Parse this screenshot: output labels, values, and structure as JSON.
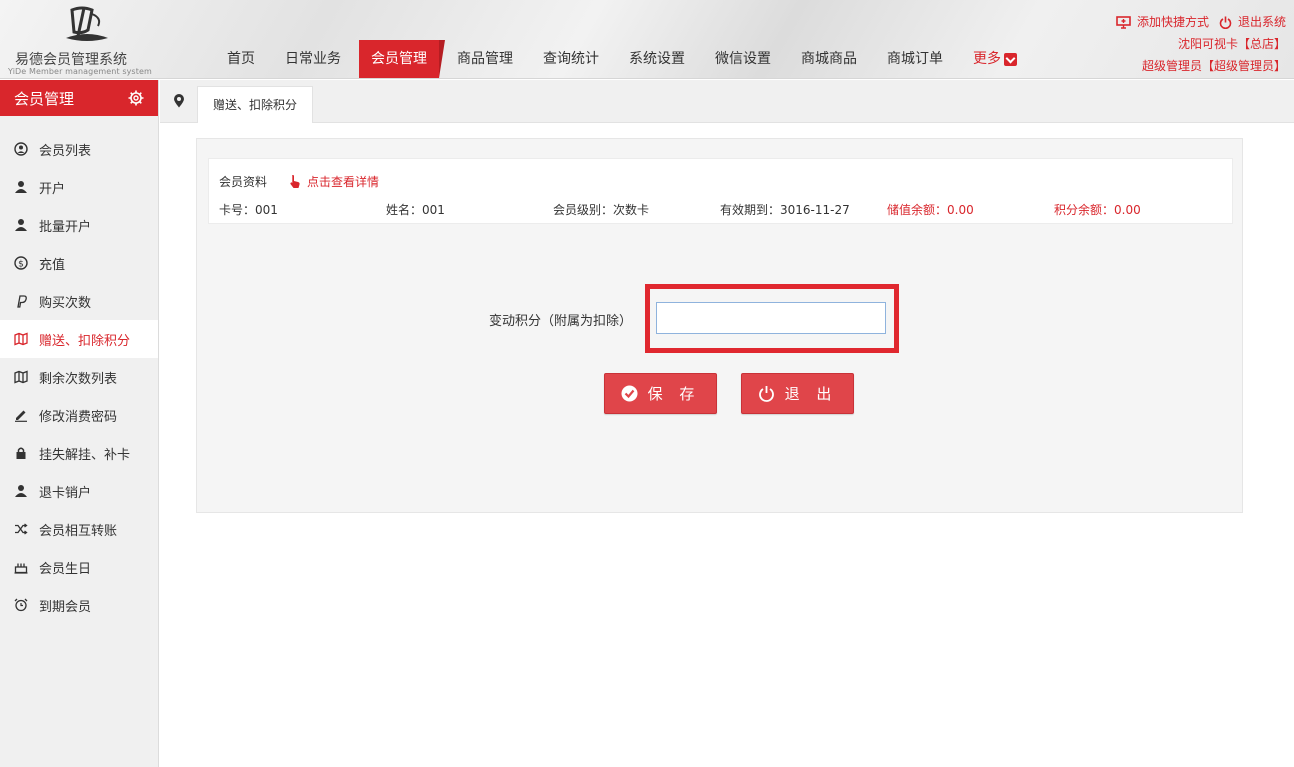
{
  "header": {
    "logo_title": "易德会员管理系统",
    "logo_subtitle": "YiDe Member management system",
    "nav": [
      "首页",
      "日常业务",
      "会员管理",
      "商品管理",
      "查询统计",
      "系统设置",
      "微信设置",
      "商城商品",
      "商城订单"
    ],
    "nav_more": "更多",
    "add_shortcut": "添加快捷方式",
    "logout": "退出系统",
    "store": "沈阳可视卡【总店】",
    "user": "超级管理员【超级管理员】"
  },
  "sidebar": {
    "title": "会员管理",
    "items": [
      {
        "label": "会员列表",
        "icon": "user-circle-icon"
      },
      {
        "label": "开户",
        "icon": "user-icon"
      },
      {
        "label": "批量开户",
        "icon": "user-icon"
      },
      {
        "label": "充值",
        "icon": "coin-icon"
      },
      {
        "label": "购买次数",
        "icon": "paypal-icon"
      },
      {
        "label": "赠送、扣除积分",
        "icon": "map-icon"
      },
      {
        "label": "剩余次数列表",
        "icon": "map-icon"
      },
      {
        "label": "修改消费密码",
        "icon": "pencil-icon"
      },
      {
        "label": "挂失解挂、补卡",
        "icon": "lock-icon"
      },
      {
        "label": "退卡销户",
        "icon": "user-icon"
      },
      {
        "label": "会员相互转账",
        "icon": "shuffle-icon"
      },
      {
        "label": "会员生日",
        "icon": "cake-icon"
      },
      {
        "label": "到期会员",
        "icon": "alarm-clock-icon"
      }
    ],
    "active_index": 5
  },
  "tab": {
    "label": "赠送、扣除积分"
  },
  "member": {
    "section_title": "会员资料",
    "detail_link": "点击查看详情",
    "card_no": "卡号：001",
    "name": "姓名：001",
    "level": "会员级别：次数卡",
    "expire": "有效期到：3016-11-27",
    "balance": "储值余额：0.00",
    "points": "积分余额：0.00"
  },
  "form": {
    "label": "变动积分（附属为扣除）",
    "value": "",
    "save": "保 存",
    "exit": "退 出"
  },
  "colors": {
    "accent": "#d9262c",
    "button": "#e0454a",
    "highlight": "#e0282f"
  }
}
